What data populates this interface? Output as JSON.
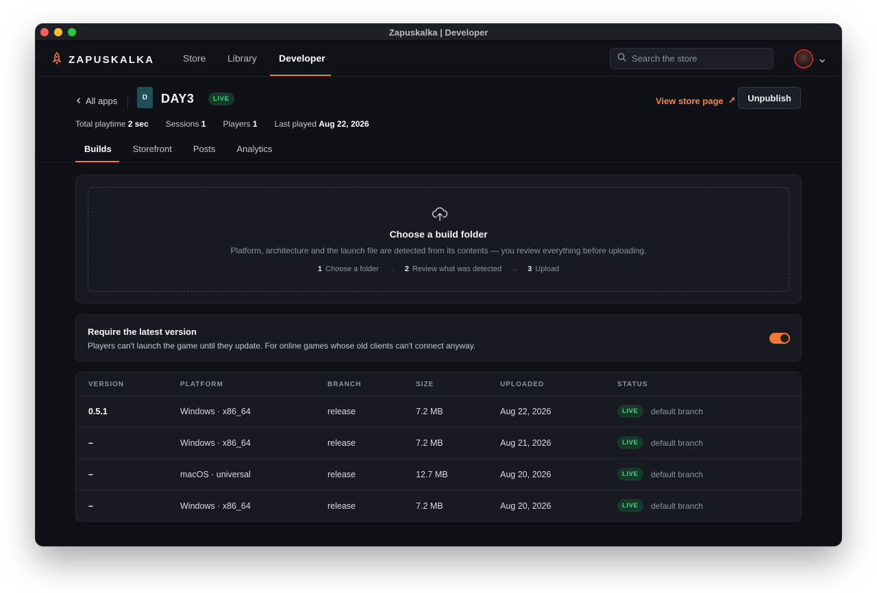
{
  "window": {
    "title": "Zapuskalka | Developer"
  },
  "nav": {
    "logo": "ZAPUSKALKA",
    "items": [
      {
        "label": "Store",
        "active": false
      },
      {
        "label": "Library",
        "active": false
      },
      {
        "label": "Developer",
        "active": true
      }
    ],
    "search_placeholder": "Search the store"
  },
  "app": {
    "back_label": "All apps",
    "icon_letter": "D",
    "name": "DAY3",
    "status": "LIVE",
    "view_store": "View store page",
    "view_store_arrow": "↗",
    "unpublish": "Unpublish",
    "stats": [
      {
        "label": "Total playtime",
        "value": "2 sec"
      },
      {
        "label": "Sessions",
        "value": "1"
      },
      {
        "label": "Players",
        "value": "1"
      },
      {
        "label": "Last played",
        "value": "Aug 22, 2026"
      }
    ],
    "tabs": [
      {
        "label": "Builds",
        "active": true
      },
      {
        "label": "Storefront",
        "active": false
      },
      {
        "label": "Posts",
        "active": false
      },
      {
        "label": "Analytics",
        "active": false
      }
    ]
  },
  "upload": {
    "title": "Choose a build folder",
    "subtitle": "Platform, architecture and the launch file are detected from its contents — you review everything before uploading.",
    "steps": [
      {
        "num": "1",
        "label": "Choose a folder"
      },
      {
        "num": "2",
        "label": "Review what was detected"
      },
      {
        "num": "3",
        "label": "Upload"
      }
    ]
  },
  "latest": {
    "title": "Require the latest version",
    "description": "Players can't launch the game until they update. For online games whose old clients can't connect anyway.",
    "enabled": true
  },
  "builds": {
    "headers": [
      "VERSION",
      "PLATFORM",
      "BRANCH",
      "SIZE",
      "UPLOADED",
      "STATUS"
    ],
    "rows": [
      {
        "version": "0.5.1",
        "platform": "Windows · x86_64",
        "branch": "release",
        "size": "7.2 MB",
        "uploaded": "Aug 22, 2026",
        "status": "LIVE",
        "note": "default branch"
      },
      {
        "version": "–",
        "platform": "Windows · x86_64",
        "branch": "release",
        "size": "7.2 MB",
        "uploaded": "Aug 21, 2026",
        "status": "LIVE",
        "note": "default branch"
      },
      {
        "version": "–",
        "platform": "macOS · universal",
        "branch": "release",
        "size": "12.7 MB",
        "uploaded": "Aug 20, 2026",
        "status": "LIVE",
        "note": "default branch"
      },
      {
        "version": "–",
        "platform": "Windows · x86_64",
        "branch": "release",
        "size": "7.2 MB",
        "uploaded": "Aug 20, 2026",
        "status": "LIVE",
        "note": "default branch"
      }
    ]
  },
  "colors": {
    "accent": "#f2783a",
    "live": "#42d77d",
    "bg": "#0f1116"
  }
}
